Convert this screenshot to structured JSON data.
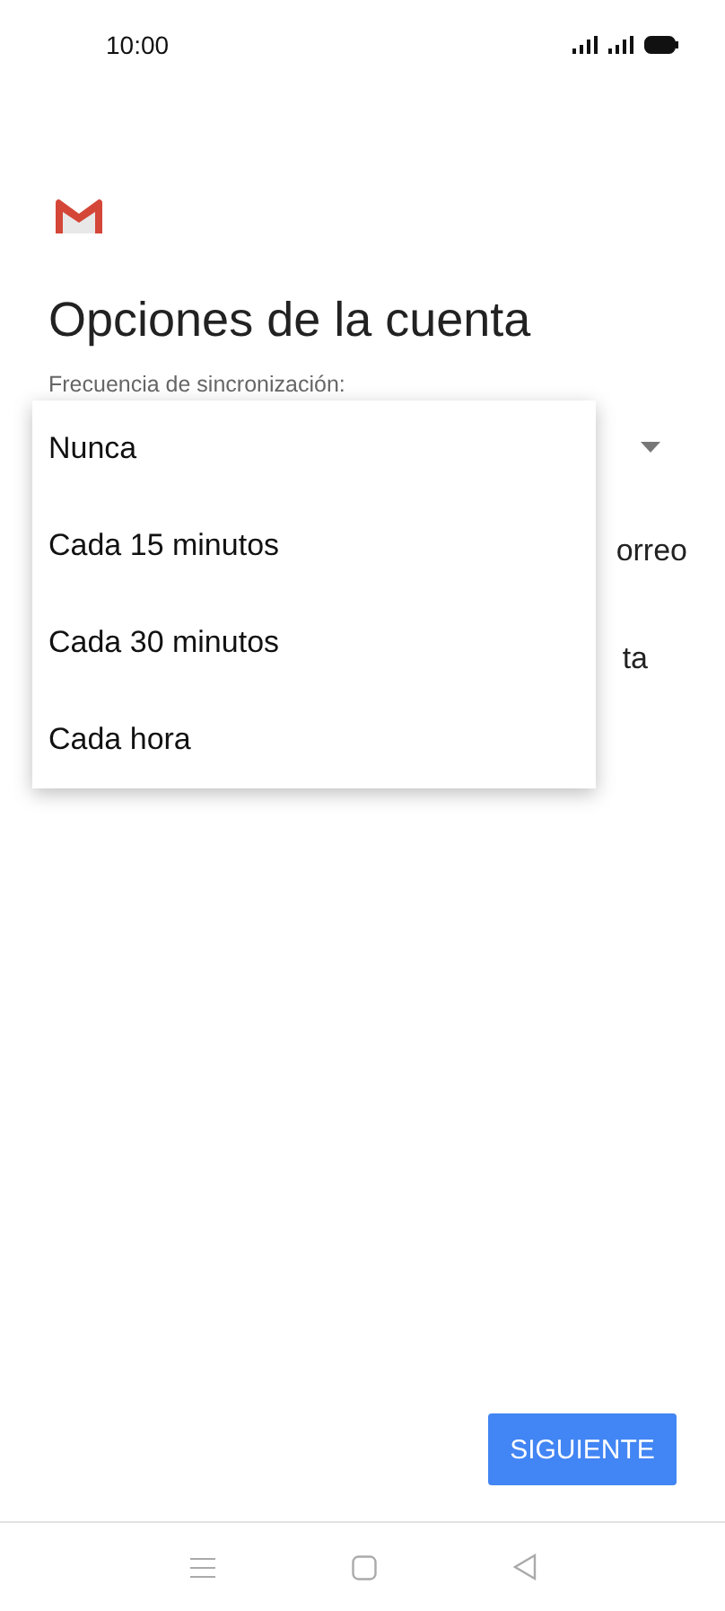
{
  "status_bar": {
    "time": "10:00"
  },
  "title": "Opciones de la cuenta",
  "sync_label": "Frecuencia de sincronización:",
  "covered_options": [
    "orreo",
    "ta"
  ],
  "menu": {
    "options": [
      "Nunca",
      "Cada 15 minutos",
      "Cada 30 minutos",
      "Cada hora"
    ]
  },
  "next_button": "SIGUIENTE"
}
